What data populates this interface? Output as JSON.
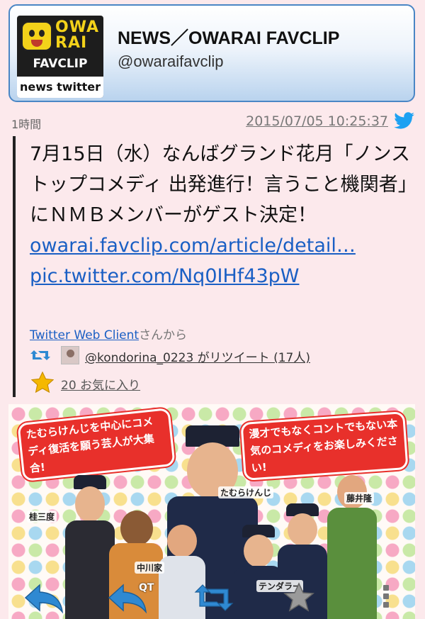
{
  "account": {
    "name": "NEWS／OWARAI FAVCLIP",
    "handle": "@owaraifavclip",
    "avatar_logo": {
      "line1": "OWA RAI",
      "line2": "FAVCLIP",
      "line3": "news twitter"
    }
  },
  "meta": {
    "relative_time": "1時間",
    "timestamp": "2015/07/05 10:25:37"
  },
  "tweet": {
    "text": "7月15日（水）なんばグランド花月「ノンストップコメディ 出発進行！言うこと機関者」にＮＭＢメンバーがゲスト決定！ ",
    "link1": "owarai.favclip.com/article/detail…",
    "link2": "pic.twitter.com/Nq0IHf43pW",
    "client_link": "Twitter Web Client",
    "client_suffix": "さんから",
    "retweet_text": "@kondorina_0223 がリツイート (17人)",
    "favorites_text": "20 お気に入り"
  },
  "photo": {
    "caption_left": "たむらけんじを中心にコメディ復活を願う芸人が大集合!",
    "caption_right": "漫才でもなくコントでもない本気のコメディをお楽しみください!",
    "name_tags": [
      "たむらけんじ",
      "桂三度",
      "中川家",
      "テンダラー",
      "藤井隆"
    ]
  },
  "actions": {
    "qt_label": "QT",
    "icons": [
      "reply-icon",
      "quote-icon",
      "retweet-icon",
      "favorite-star-icon",
      "more-icon"
    ]
  },
  "colors": {
    "background": "#fce9ec",
    "link": "#1a5fc4",
    "header_border": "#4a86c5",
    "twitter_blue": "#1da1f2",
    "star_gold": "#f5b800"
  }
}
